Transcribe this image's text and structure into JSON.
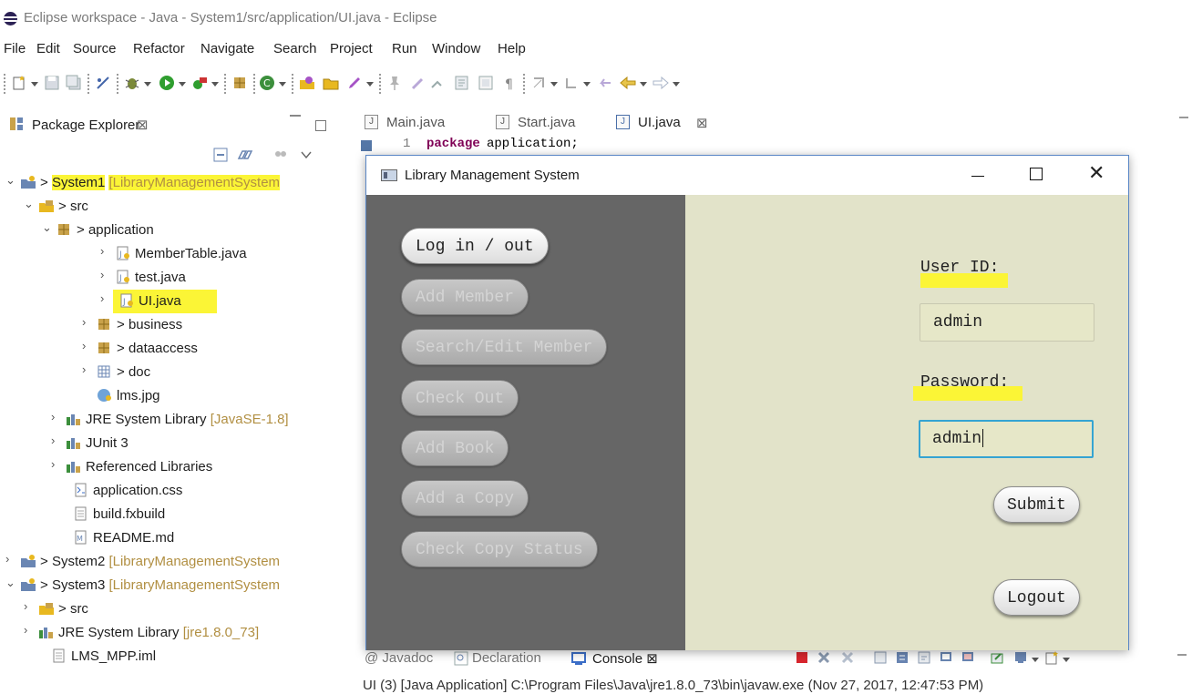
{
  "window": {
    "title": "Eclipse workspace - Java - System1/src/application/UI.java - Eclipse"
  },
  "menu": [
    "File",
    "Edit",
    "Source",
    "Refactor",
    "Navigate",
    "Search",
    "Project",
    "Run",
    "Window",
    "Help"
  ],
  "package_explorer": {
    "title": "Package Explorer",
    "close": "⊠",
    "tree": [
      {
        "label": "System1",
        "suffix": "[LibraryManagementSystem",
        "prefix": "> "
      },
      {
        "label": "src",
        "prefix": "> "
      },
      {
        "label": "application",
        "prefix": "> "
      },
      {
        "label": "MemberTable.java"
      },
      {
        "label": "test.java"
      },
      {
        "label": "UI.java"
      },
      {
        "label": "business",
        "prefix": "> "
      },
      {
        "label": "dataaccess",
        "prefix": "> "
      },
      {
        "label": "doc",
        "prefix": "> "
      },
      {
        "label": "lms.jpg"
      },
      {
        "label": "JRE System Library",
        "suffix": "[JavaSE-1.8]"
      },
      {
        "label": "JUnit 3"
      },
      {
        "label": "Referenced Libraries"
      },
      {
        "label": "application.css"
      },
      {
        "label": "build.fxbuild"
      },
      {
        "label": "README.md"
      },
      {
        "label": "System2",
        "suffix": "[LibraryManagementSystem",
        "prefix": "> "
      },
      {
        "label": "System3",
        "suffix": "[LibraryManagementSystem",
        "prefix": "> "
      },
      {
        "label": "src",
        "prefix": "> "
      },
      {
        "label": "JRE System Library",
        "suffix": "[jre1.8.0_73]"
      },
      {
        "label": "LMS_MPP.iml"
      }
    ]
  },
  "editor": {
    "tabs": [
      {
        "label": "Main.java"
      },
      {
        "label": "Start.java"
      },
      {
        "label": "UI.java",
        "close": "⊠"
      }
    ],
    "line_number": "1",
    "code_keyword": "package",
    "code_rest": "application;"
  },
  "bottom_panel": {
    "tabs": [
      "@ Javadoc",
      "Declaration",
      "Console ⊠"
    ],
    "status": "UI (3) [Java Application] C:\\Program Files\\Java\\jre1.8.0_73\\bin\\javaw.exe (Nov 27, 2017, 12:47:53 PM)"
  },
  "lms": {
    "title": "Library Management System",
    "close_glyph": "✕",
    "nav_buttons": [
      {
        "label": "Log in / out",
        "enabled": true
      },
      {
        "label": "Add Member",
        "enabled": false
      },
      {
        "label": "Search/Edit Member",
        "enabled": false
      },
      {
        "label": "Check Out",
        "enabled": false
      },
      {
        "label": "Add Book",
        "enabled": false
      },
      {
        "label": "Add a Copy",
        "enabled": false
      },
      {
        "label": "Check Copy Status",
        "enabled": false
      }
    ],
    "user_id_label": "User ID:",
    "user_id_value": "admin",
    "password_label": "Password:",
    "password_value": "admin",
    "submit_label": "Submit",
    "logout_label": "Logout"
  },
  "colors": {
    "highlight": "#fbf536",
    "lms_left_bg": "#666666",
    "lms_right_bg": "#e2e3c9",
    "focus_border": "#35a4d2"
  }
}
